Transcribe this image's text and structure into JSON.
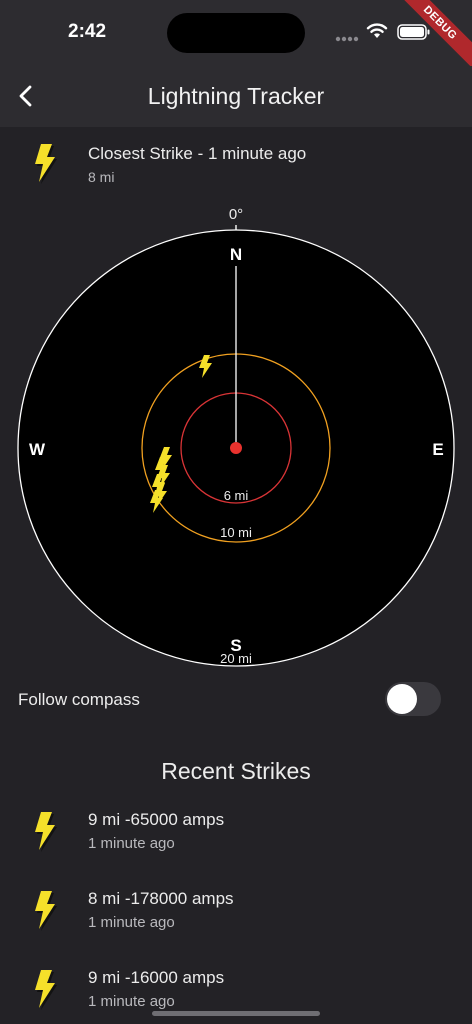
{
  "status_bar": {
    "time": "2:42"
  },
  "debug_banner": "DEBUG",
  "app_bar": {
    "title": "Lightning Tracker"
  },
  "closest_strike": {
    "title": "Closest Strike - 1 minute ago",
    "distance": "8 mi"
  },
  "radar": {
    "heading_label": "0°",
    "directions": {
      "north": "N",
      "south": "S",
      "east": "E",
      "west": "W"
    },
    "rings": [
      {
        "label": "6 mi",
        "color": "#d93436"
      },
      {
        "label": "10 mi",
        "color": "#f0a020"
      },
      {
        "label": "20 mi",
        "color": "#ffffff"
      }
    ],
    "center_color": "#e8322e",
    "strike_color": "#f5e02a"
  },
  "follow_compass": {
    "label": "Follow compass",
    "enabled": false
  },
  "recent": {
    "title": "Recent Strikes",
    "items": [
      {
        "title": "9 mi -65000 amps",
        "time": "1 minute ago"
      },
      {
        "title": "8 mi -178000 amps",
        "time": "1 minute ago"
      },
      {
        "title": "9 mi -16000 amps",
        "time": "1 minute ago"
      }
    ]
  }
}
